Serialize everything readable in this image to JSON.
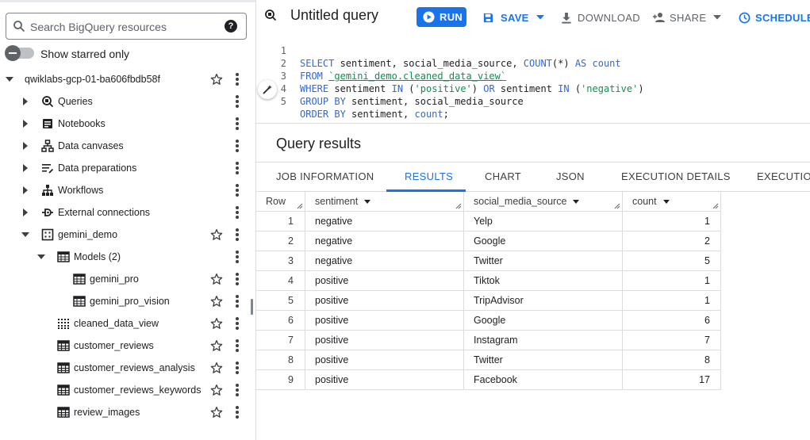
{
  "explorer": {
    "search_placeholder": "Search BigQuery resources",
    "help_icon": "?",
    "show_starred_label": "Show starred only",
    "project": "qwiklabs-gcp-01-ba606fbdb58f",
    "items": [
      {
        "label": "Queries",
        "icon": "query-icon"
      },
      {
        "label": "Notebooks",
        "icon": "notebook-icon"
      },
      {
        "label": "Data canvases",
        "icon": "canvas-icon"
      },
      {
        "label": "Data preparations",
        "icon": "data-prep-icon"
      },
      {
        "label": "Workflows",
        "icon": "workflow-icon"
      },
      {
        "label": "External connections",
        "icon": "connection-icon"
      }
    ],
    "dataset": "gemini_demo",
    "models_label": "Models (2)",
    "models": [
      "gemini_pro",
      "gemini_pro_vision"
    ],
    "tables": [
      {
        "label": "cleaned_data_view",
        "icon": "view-icon"
      },
      {
        "label": "customer_reviews",
        "icon": "table-icon"
      },
      {
        "label": "customer_reviews_analysis",
        "icon": "table-icon"
      },
      {
        "label": "customer_reviews_keywords",
        "icon": "table-icon"
      },
      {
        "label": "review_images",
        "icon": "table-icon"
      }
    ]
  },
  "toolbar": {
    "title": "Untitled query",
    "run": "RUN",
    "save": "SAVE",
    "download": "DOWNLOAD",
    "share": "SHARE",
    "schedule": "SCHEDULE"
  },
  "editor": {
    "line_numbers": [
      "1",
      "2",
      "3",
      "4",
      "5"
    ],
    "l1": {
      "kw1": "SELECT",
      "t1": " sentiment, social_media_source, ",
      "fn": "COUNT",
      "t2": "(*) ",
      "kw2": "AS",
      "kw3": " count"
    },
    "l2": {
      "kw1": "FROM",
      "t1": " ",
      "tbl": "`gemini_demo.cleaned_data_view`"
    },
    "l3": {
      "kw1": "WHERE",
      "t1": " sentiment ",
      "kw2": "IN",
      "t2": " (",
      "s1": "'positive'",
      "t3": ") ",
      "kw3": "OR",
      "t4": " sentiment ",
      "kw4": "IN",
      "t5": " (",
      "s2": "'negative'",
      "t6": ")"
    },
    "l4": {
      "kw1": "GROUP BY",
      "t1": " sentiment, social_media_source"
    },
    "l5": {
      "kw1": "ORDER BY",
      "t1": " sentiment, ",
      "kw2": "count",
      "t2": ";"
    }
  },
  "results": {
    "title": "Query results",
    "tabs": [
      "JOB INFORMATION",
      "RESULTS",
      "CHART",
      "JSON",
      "EXECUTION DETAILS",
      "EXECUTION"
    ],
    "active_tab": "RESULTS",
    "columns": [
      "Row",
      "sentiment",
      "social_media_source",
      "count"
    ],
    "rows": [
      [
        "1",
        "negative",
        "Yelp",
        "1"
      ],
      [
        "2",
        "negative",
        "Google",
        "2"
      ],
      [
        "3",
        "negative",
        "Twitter",
        "5"
      ],
      [
        "4",
        "positive",
        "Tiktok",
        "1"
      ],
      [
        "5",
        "positive",
        "TripAdvisor",
        "1"
      ],
      [
        "6",
        "positive",
        "Google",
        "6"
      ],
      [
        "7",
        "positive",
        "Instagram",
        "7"
      ],
      [
        "8",
        "positive",
        "Twitter",
        "8"
      ],
      [
        "9",
        "positive",
        "Facebook",
        "17"
      ]
    ]
  },
  "colors": {
    "accent": "#1a73e8",
    "keyword": "#3367d6",
    "string": "#0d904f"
  }
}
